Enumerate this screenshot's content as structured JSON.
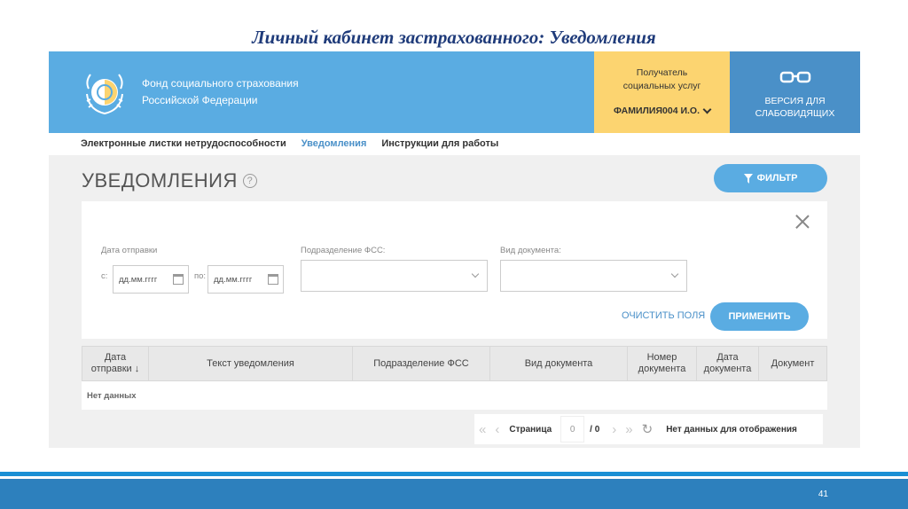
{
  "slide_title": "Личный кабинет застрахованного: Уведомления",
  "header": {
    "org_line1": "Фонд социального страхования",
    "org_line2": "Российской Федерации",
    "recipient_label_line1": "Получатель",
    "recipient_label_line2": "социальных услуг",
    "user_name": "ФАМИЛИЯ004 И.О.",
    "vision_line1": "ВЕРСИЯ ДЛЯ",
    "vision_line2": "СЛАБОВИДЯЩИХ"
  },
  "nav": {
    "items": [
      {
        "label": "Электронные листки нетрудоспособности",
        "active": false
      },
      {
        "label": "Уведомления",
        "active": true
      },
      {
        "label": "Инструкции для работы",
        "active": false
      }
    ]
  },
  "page": {
    "title": "УВЕДОМЛЕНИЯ",
    "help": "?",
    "filter_button": "ФИЛЬТР"
  },
  "filters": {
    "date_label": "Дата отправки",
    "from_label": "с:",
    "to_label": "по:",
    "date_placeholder": "дд.мм.гггг",
    "dept_label": "Подразделение ФСС:",
    "doctype_label": "Вид документа:",
    "clear": "ОЧИСТИТЬ ПОЛЯ",
    "apply": "ПРИМЕНИТЬ"
  },
  "table": {
    "columns": [
      {
        "line1": "Дата",
        "line2": "отправки ↓"
      },
      {
        "line1": "Текст уведомления",
        "line2": ""
      },
      {
        "line1": "Подразделение ФСС",
        "line2": ""
      },
      {
        "line1": "Вид документа",
        "line2": ""
      },
      {
        "line1": "Номер",
        "line2": "документа"
      },
      {
        "line1": "Дата",
        "line2": "документа"
      },
      {
        "line1": "Документ",
        "line2": ""
      }
    ],
    "empty_text": "Нет данных"
  },
  "pager": {
    "first": "«",
    "prev": "‹",
    "page_label": "Страница",
    "page_value": "0",
    "total": "/ 0",
    "next": "›",
    "last": "»",
    "refresh": "↻",
    "status": "Нет данных для отображения"
  },
  "footer": {
    "slide_number": "41"
  },
  "colors": {
    "header_blue": "#5aace2",
    "recipient_yellow": "#fcd470",
    "vision_blue": "#4a90c8",
    "footer_blue": "#2d80bd"
  }
}
